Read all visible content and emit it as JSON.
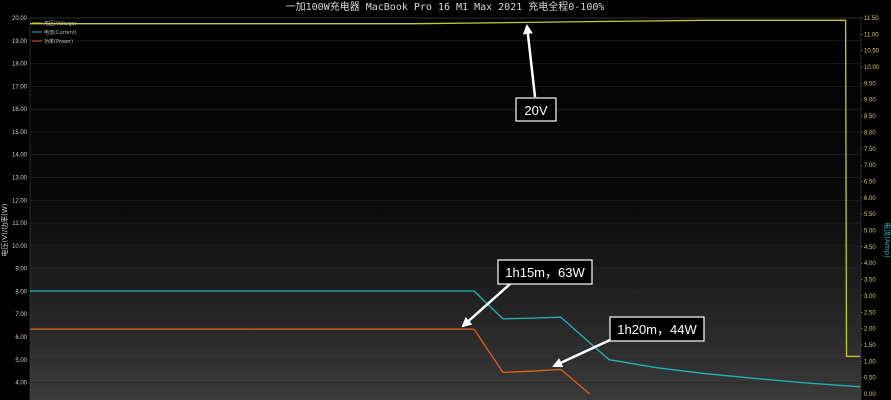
{
  "chart_data": {
    "type": "line",
    "title": "一加100W充电器 MacBook Pro 16 M1 Max 2021 充电全程0-100%",
    "ylabel_left": "电压(V)/功率(W)",
    "ylabel_right": "电流(Amp)",
    "ylim_left": [
      3.5,
      20.0
    ],
    "ylim_right": [
      0.0,
      11.5
    ],
    "yticks_left": [
      "20.00",
      "19.00",
      "18.00",
      "17.00",
      "16.00",
      "15.00",
      "14.00",
      "13.00",
      "12.00",
      "11.00",
      "10.00",
      "9.00",
      "8.00",
      "7.00",
      "6.00",
      "5.00",
      "4.00"
    ],
    "yticks_right": [
      "11.50",
      "11.00",
      "10.50",
      "10.00",
      "9.50",
      "9.00",
      "8.50",
      "8.00",
      "7.50",
      "7.00",
      "6.50",
      "6.00",
      "5.50",
      "5.00",
      "4.50",
      "4.00",
      "3.50",
      "3.00",
      "2.50",
      "2.00",
      "1.50",
      "1.00",
      "0.50",
      "0.00"
    ],
    "grid": true,
    "legend": [
      {
        "name": "电压(Voltage)",
        "color": "#c8c832"
      },
      {
        "name": "电流(Current)",
        "color": "#1fb5b5"
      },
      {
        "name": "功率(Power)",
        "color": "#e0601a"
      }
    ],
    "series": [
      {
        "name": "电压(Voltage)",
        "axis": "left",
        "color": "#c8c832",
        "x": [
          0,
          400,
          600,
          700,
          845,
          846,
          860
        ],
        "y": [
          19.75,
          19.75,
          19.85,
          19.9,
          19.9,
          5.15,
          5.15
        ]
      },
      {
        "name": "电流(Current)",
        "axis": "right",
        "color": "#1fb5b5",
        "x": [
          0,
          460,
          490,
          520,
          550,
          600,
          650,
          700,
          750,
          800,
          860
        ],
        "y": [
          3.15,
          3.15,
          2.3,
          2.32,
          2.35,
          1.05,
          0.8,
          0.62,
          0.48,
          0.35,
          0.22
        ]
      },
      {
        "name": "功率(Power)",
        "axis": "left",
        "color": "#e0601a",
        "x": [
          0,
          460,
          490,
          520,
          550,
          580
        ],
        "y": [
          6.35,
          6.35,
          4.45,
          4.5,
          4.58,
          3.5
        ]
      }
    ],
    "annotations": [
      {
        "text": "20V"
      },
      {
        "text": "1h15m，63W"
      },
      {
        "text": "1h20m，44W"
      }
    ]
  }
}
